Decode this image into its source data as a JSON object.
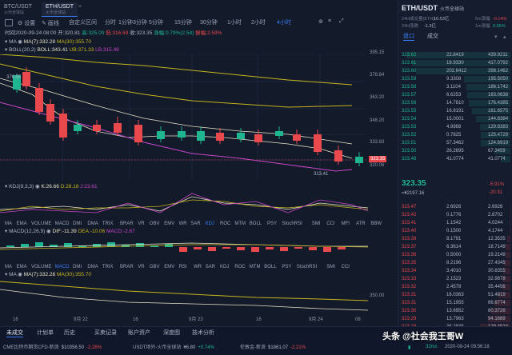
{
  "tabs": [
    {
      "label": "BTC/USDT",
      "sub": "火币全球站"
    },
    {
      "label": "ETH/USDT",
      "sub": "火币全球站"
    }
  ],
  "toolbar": {
    "type_label": "自定义区间",
    "timeframes": [
      "分时",
      "1分钟",
      "3分钟",
      "5分钟",
      "15分钟",
      "30分钟",
      "1小时",
      "2小时",
      "4小时"
    ],
    "active_timeframe": "4小时"
  },
  "info_line": {
    "time": "时间2020-09-24 08:00",
    "open": "开:320.81",
    "high": "高:325.00",
    "low": "低:316.69",
    "close": "收:323.35",
    "change_pct": "涨幅:0.79%(2.54)",
    "amplitude": "振幅:2.59%"
  },
  "ma_line": {
    "name": "MA",
    "ma7": "MA(7):332.28",
    "ma30": "MA(30):355.70"
  },
  "boll_line": {
    "name": "BOLL(20,2)",
    "boll": "BOLL:343.41",
    "ub": "UB:371.33",
    "lb": "LB:315.49"
  },
  "price_axis": [
    "395.15",
    "378.84",
    "363.20",
    "348.20",
    "333.83",
    "320.06"
  ],
  "price_labels": {
    "left_high": "376.95",
    "low": "313.41",
    "current": "323.35"
  },
  "kdj": {
    "name": "KDJ(9,3,3)",
    "k": "K:26.66",
    "d": "D:28.18",
    "j": "J:23.61"
  },
  "indicator_tabs_1": [
    "MA",
    "EMA",
    "VOLUME",
    "MACD",
    "DMI",
    "DMA",
    "TRIX",
    "BRAR",
    "VR",
    "OBV",
    "EMV",
    "WR",
    "SAR",
    "KDJ",
    "ROC",
    "MTM",
    "BOLL",
    "PSY",
    "StochRSI",
    "SMI",
    "CCI",
    "MFI",
    "ATR",
    "BBW"
  ],
  "macd": {
    "name": "MACD(12,26,9)",
    "dif": "DIF:-11.39",
    "dea": "DEA:-10.06",
    "macd": "MACD:-2.67"
  },
  "indicator_tabs_2": [
    "MA",
    "EMA",
    "VOLUME",
    "MACD",
    "DMI",
    "DMA",
    "TRIX",
    "BRAR",
    "VR",
    "OBV",
    "EMV",
    "RSI",
    "WR",
    "SAR",
    "KDJ",
    "ROC",
    "MTM",
    "BOLL",
    "PSY",
    "StochRSI",
    "SMI",
    "CCI"
  ],
  "ma2_line": {
    "name": "MA",
    "ma7": "MA(7):332.28",
    "ma30": "MA(30):355.70"
  },
  "ma2_axis": [
    "350.00"
  ],
  "date_axis": [
    "16",
    "9月 22",
    "16",
    "9月 23",
    "16",
    "9月 24",
    "08"
  ],
  "right_panel": {
    "pair": "ETH/USDT",
    "exchange": "火币全球站",
    "stats": [
      {
        "label": "24H成交量(ETH)",
        "value": "16.53亿"
      },
      {
        "label": "5m涨幅",
        "value": "-0.14%"
      },
      {
        "label": "24H涨跌",
        "value": "-1.3亿"
      },
      {
        "label": "1m涨幅",
        "value": "0.65%"
      }
    ],
    "tabs": [
      "盘口",
      "成交"
    ],
    "current_price": "323.35",
    "current_cny": "≈¥2197.16",
    "change_pct": "-5.91%",
    "change_abs": "-20.31",
    "asks": [
      [
        "323.62",
        "22.8419",
        "439.9211"
      ],
      [
        "323.61",
        "18.9330",
        "417.0792"
      ],
      [
        "323.60",
        "202.6412",
        "398.1462"
      ],
      [
        "323.59",
        "9.3308",
        "195.5050"
      ],
      [
        "323.58",
        "3.1104",
        "186.1742"
      ],
      [
        "323.57",
        "6.6253",
        "183.0638"
      ],
      [
        "323.56",
        "14.7810",
        "176.4385"
      ],
      [
        "323.55",
        "16.8191",
        "161.6575"
      ],
      [
        "323.54",
        "15.0001",
        "144.8384"
      ],
      [
        "323.53",
        "4.9988",
        "129.8383"
      ],
      [
        "323.52",
        "0.7825",
        "125.4729"
      ],
      [
        "323.51",
        "57.3462",
        "124.6919"
      ],
      [
        "323.50",
        "26.2695",
        "67.3459"
      ],
      [
        "323.48",
        "41.0774",
        "41.0774"
      ]
    ],
    "bids": [
      [
        "323.47",
        "2.6926",
        "2.6926"
      ],
      [
        "323.42",
        "0.1776",
        "2.8702"
      ],
      [
        "323.41",
        "1.1542",
        "4.0244"
      ],
      [
        "323.40",
        "0.1500",
        "4.1744"
      ],
      [
        "323.39",
        "8.1791",
        "12.3535"
      ],
      [
        "323.37",
        "6.3614",
        "18.7149"
      ],
      [
        "323.36",
        "0.5000",
        "19.2149"
      ],
      [
        "323.35",
        "8.2196",
        "27.4345"
      ],
      [
        "323.34",
        "3.4010",
        "30.8355"
      ],
      [
        "323.33",
        "2.1523",
        "32.9878"
      ],
      [
        "323.32",
        "2.4578",
        "35.4456"
      ],
      [
        "323.31",
        "16.0363",
        "51.4819"
      ],
      [
        "323.31",
        "15.1955",
        "66.6774"
      ],
      [
        "323.30",
        "13.6952",
        "80.3726"
      ],
      [
        "323.29",
        "13.7963",
        "94.1689"
      ],
      [
        "323.28",
        "35.2835",
        "129.4524"
      ]
    ]
  },
  "bottom_tabs": [
    "未成交",
    "计划单",
    "历史",
    "买卖记录",
    "账户资产",
    "深度图",
    "技术分析"
  ],
  "tickers": [
    {
      "label": "CME比特币期货CFD-新浪",
      "value": "$10356.50",
      "change": "-2.26%"
    },
    {
      "label": "USDT场外-火币全球站",
      "value": "¥6.80",
      "change": "+0.74%"
    },
    {
      "label": "伦敦金-新浪",
      "value": "$1861.07",
      "change": "-2.21%"
    }
  ],
  "status": {
    "network": "32ms",
    "datetime": "2020-09-24 09:56:18"
  },
  "watermark": "头条 @社会我王哥W",
  "colors": {
    "up": "#1fb590",
    "down": "#e9484d",
    "accent": "#3b7cf6",
    "ma7": "#e8e3c4",
    "ma30": "#c6b41f",
    "boll_lb": "#c846c8"
  }
}
